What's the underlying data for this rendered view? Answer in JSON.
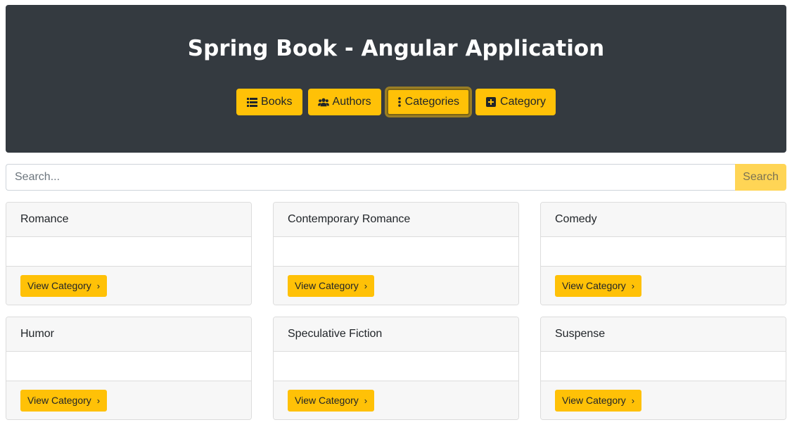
{
  "header": {
    "title": "Spring Book - Angular Application",
    "nav": [
      {
        "label": "Books",
        "icon": "list-icon"
      },
      {
        "label": "Authors",
        "icon": "users-icon"
      },
      {
        "label": "Categories",
        "icon": "ellipsis-vertical-icon",
        "active": true
      },
      {
        "label": "Category",
        "icon": "plus-square-icon"
      }
    ]
  },
  "search": {
    "placeholder": "Search...",
    "value": "",
    "button_label": "Search"
  },
  "categories": [
    {
      "name": "Romance",
      "button_label": "View Category"
    },
    {
      "name": "Contemporary Romance",
      "button_label": "View Category"
    },
    {
      "name": "Comedy",
      "button_label": "View Category"
    },
    {
      "name": "Humor",
      "button_label": "View Category"
    },
    {
      "name": "Speculative Fiction",
      "button_label": "View Category"
    },
    {
      "name": "Suspense",
      "button_label": "View Category"
    }
  ],
  "colors": {
    "header_bg": "#343a40",
    "accent": "#ffc107",
    "search_button": "#ffd555"
  }
}
